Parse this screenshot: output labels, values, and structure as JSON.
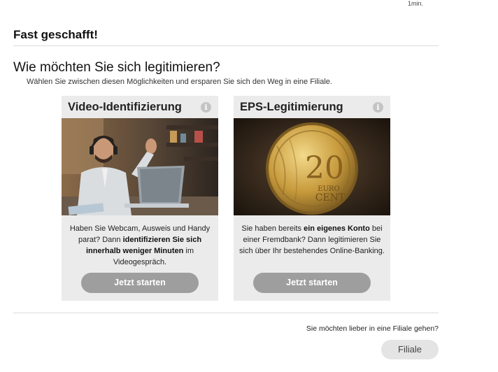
{
  "header": {
    "top_note": "1min.",
    "title": "Fast geschafft!"
  },
  "section": {
    "heading": "Wie möchten Sie sich legitimieren?",
    "subheading": "Wählen Sie zwischen diesen Möglichkeiten und ersparen Sie sich den Weg in eine Filiale."
  },
  "cards": [
    {
      "title": "Video-Identifizierung",
      "info_icon": "i",
      "image": "person-on-video-call-with-headset-and-laptop",
      "desc_parts": [
        "Haben Sie Webcam, Ausweis und Handy parat? Dann ",
        "identifizieren Sie sich innerhalb weniger Minuten",
        " im Videogespräch."
      ],
      "button": "Jetzt starten"
    },
    {
      "title": "EPS-Legitimierung",
      "info_icon": "i",
      "image": "20-euro-cent-coin",
      "coin_text": [
        "20",
        "EURO",
        "CENT"
      ],
      "desc_parts": [
        "Sie haben bereits ",
        "ein eigenes Konto",
        " bei einer Fremdbank? Dann legitimieren Sie sich über Ihr bestehendes Online-Banking."
      ],
      "button": "Jetzt starten"
    }
  ],
  "footer": {
    "question": "Sie möchten lieber in eine Filiale gehen?",
    "branch_button": "Filiale"
  },
  "colors": {
    "card_bg": "#ebebeb",
    "button_bg": "#9e9e9e",
    "branch_button_bg": "#e4e4e4"
  }
}
